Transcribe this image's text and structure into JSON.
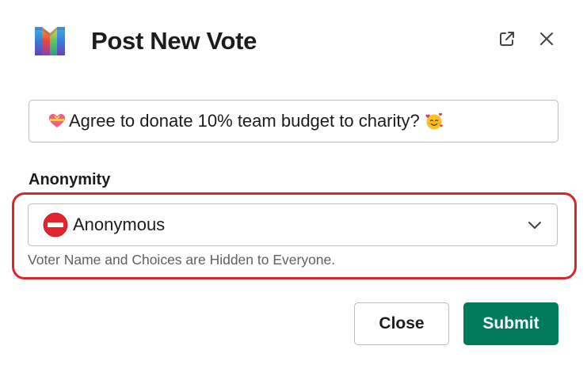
{
  "modal": {
    "title": "Post New Vote"
  },
  "question": {
    "value": "Agree to donate 10% team budget to charity?"
  },
  "anonymity": {
    "label": "Anonymity",
    "selected": "Anonymous",
    "hint": "Voter Name and Choices are Hidden to Everyone."
  },
  "footer": {
    "close_label": "Close",
    "submit_label": "Submit"
  },
  "icons": {
    "logo": "app-logo-icon",
    "popout": "external-link-icon",
    "close": "close-icon",
    "heart_gift": "heart-gift-emoji-icon",
    "smiling_hearts": "smiling-face-hearts-emoji-icon",
    "no_entry": "no-entry-icon",
    "chevron": "chevron-down-icon"
  },
  "colors": {
    "primary": "#007a5a",
    "highlight": "#d7262e",
    "text": "#1d1c1d",
    "muted": "#616061",
    "border": "#bcbcbc"
  }
}
